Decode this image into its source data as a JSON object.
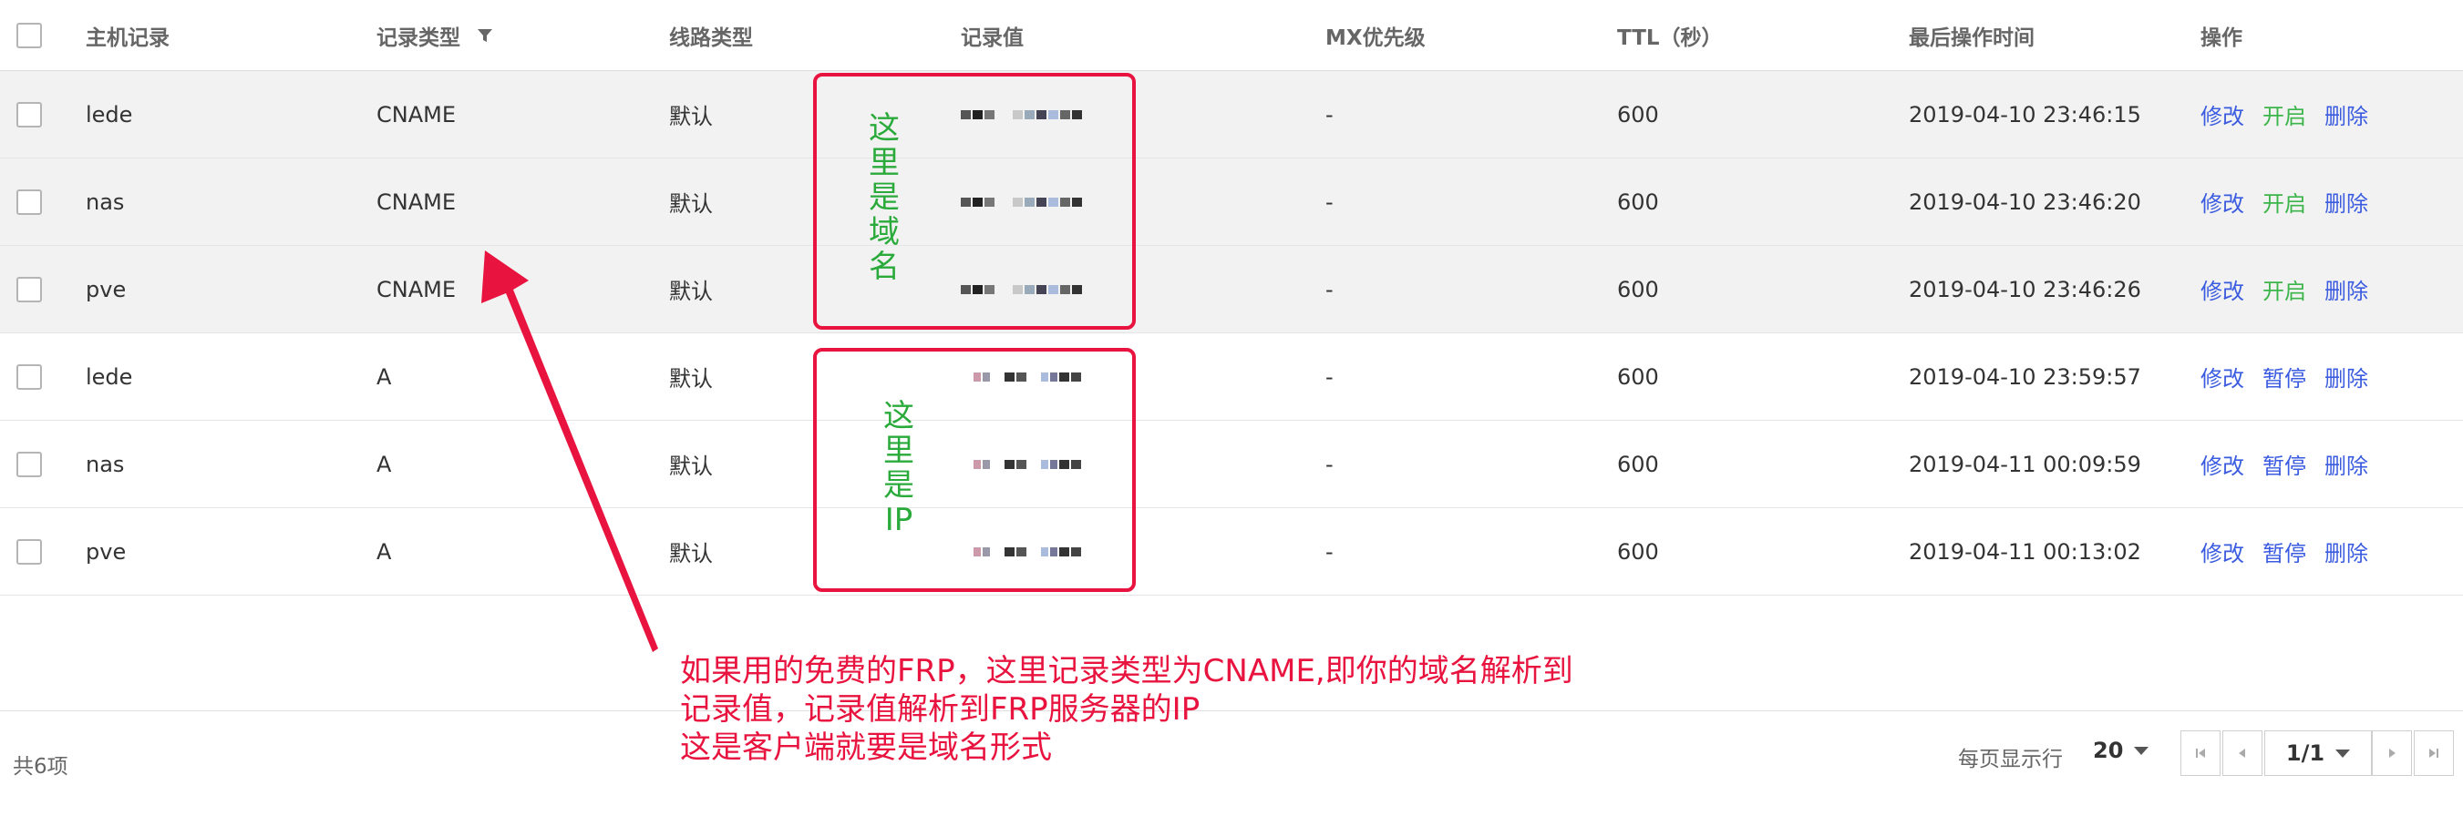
{
  "table": {
    "headers": {
      "host": "主机记录",
      "type": "记录类型",
      "line": "线路类型",
      "value": "记录值",
      "mx": "MX优先级",
      "ttl": "TTL（秒）",
      "time": "最后操作时间",
      "ops": "操作"
    },
    "rows": [
      {
        "host": "lede",
        "type": "CNAME",
        "line": "默认",
        "mx": "-",
        "ttl": "600",
        "time": "2019-04-10 23:46:15",
        "op_edit": "修改",
        "op_toggle": "开启",
        "op_delete": "删除"
      },
      {
        "host": "nas",
        "type": "CNAME",
        "line": "默认",
        "mx": "-",
        "ttl": "600",
        "time": "2019-04-10 23:46:20",
        "op_edit": "修改",
        "op_toggle": "开启",
        "op_delete": "删除"
      },
      {
        "host": "pve",
        "type": "CNAME",
        "line": "默认",
        "mx": "-",
        "ttl": "600",
        "time": "2019-04-10 23:46:26",
        "op_edit": "修改",
        "op_toggle": "开启",
        "op_delete": "删除"
      },
      {
        "host": "lede",
        "type": "A",
        "line": "默认",
        "mx": "-",
        "ttl": "600",
        "time": "2019-04-10 23:59:57",
        "op_edit": "修改",
        "op_toggle": "暂停",
        "op_delete": "删除"
      },
      {
        "host": "nas",
        "type": "A",
        "line": "默认",
        "mx": "-",
        "ttl": "600",
        "time": "2019-04-11 00:09:59",
        "op_edit": "修改",
        "op_toggle": "暂停",
        "op_delete": "删除"
      },
      {
        "host": "pve",
        "type": "A",
        "line": "默认",
        "mx": "-",
        "ttl": "600",
        "time": "2019-04-11 00:13:02",
        "op_edit": "修改",
        "op_toggle": "暂停",
        "op_delete": "删除"
      }
    ]
  },
  "overlay": {
    "domain_label": "这里是域名",
    "ip_label": "这里是IP",
    "annotation_lines": [
      "如果用的免费的FRP，这里记录类型为CNAME,即你的域名解析到",
      "记录值，记录值解析到FRP服务器的IP",
      "这是客户端就要是域名形式"
    ]
  },
  "footer": {
    "total": "共6项",
    "per_page_label": "每页显示行",
    "per_page_value": "20",
    "page_indicator": "1/1"
  },
  "colors": {
    "link": "#3b5ce0",
    "toggle_on": "#3bb54a",
    "annotation_red": "#e8143f",
    "label_green": "#2aaa3a"
  }
}
